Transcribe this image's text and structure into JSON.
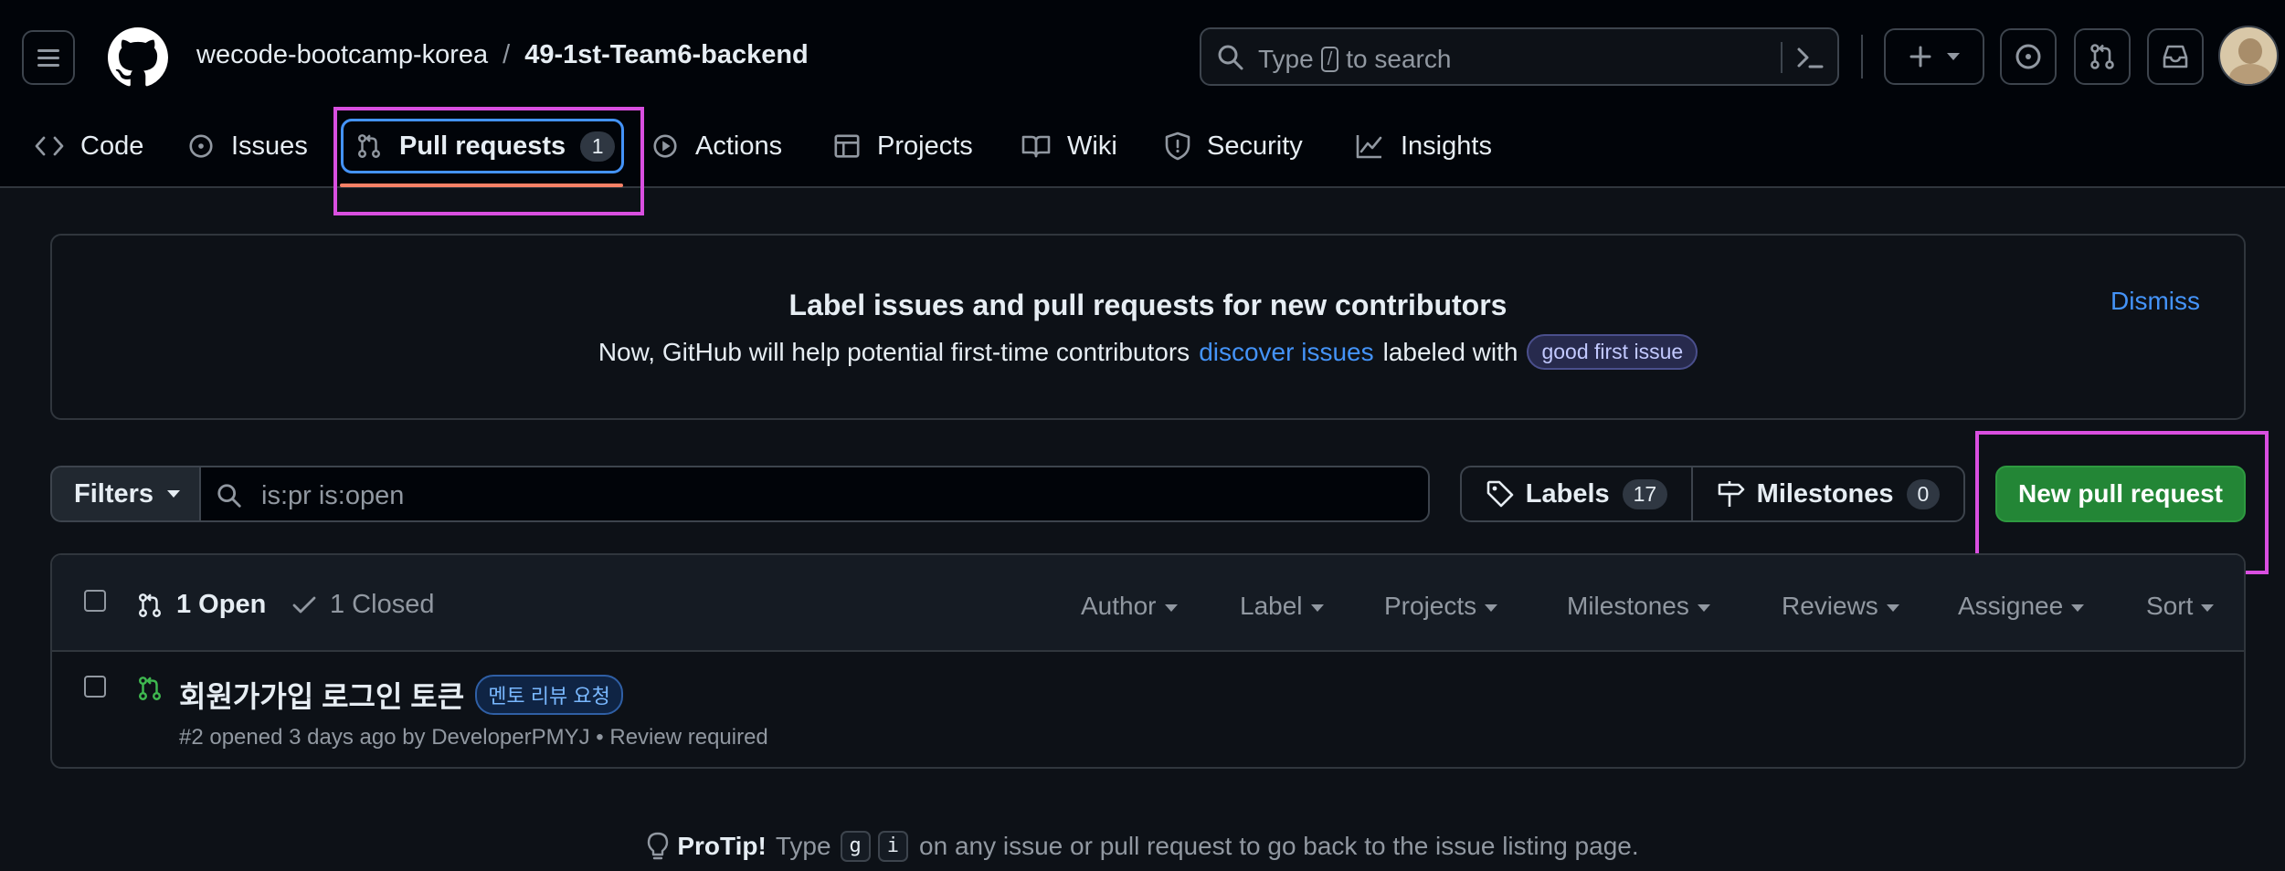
{
  "header": {
    "owner": "wecode-bootcamp-korea",
    "separator": "/",
    "repo": "49-1st-Team6-backend",
    "search_placeholder_prefix": "Type",
    "search_key": "/",
    "search_placeholder_suffix": "to search"
  },
  "tabs": [
    {
      "label": "Code",
      "icon": "code-icon"
    },
    {
      "label": "Issues",
      "icon": "issue-opened-icon"
    },
    {
      "label": "Pull requests",
      "icon": "git-pull-request-icon",
      "count": "1",
      "active": true
    },
    {
      "label": "Actions",
      "icon": "play-icon"
    },
    {
      "label": "Projects",
      "icon": "table-icon"
    },
    {
      "label": "Wiki",
      "icon": "book-icon"
    },
    {
      "label": "Security",
      "icon": "shield-icon"
    },
    {
      "label": "Insights",
      "icon": "graph-icon"
    }
  ],
  "banner": {
    "title": "Label issues and pull requests for new contributors",
    "desc_prefix": "Now, GitHub will help potential first-time contributors",
    "desc_link": "discover issues",
    "desc_mid": "labeled with",
    "label": "good first issue",
    "dismiss": "Dismiss"
  },
  "filterbar": {
    "filters_label": "Filters",
    "query": "is:pr is:open",
    "labels_label": "Labels",
    "labels_count": "17",
    "milestones_label": "Milestones",
    "milestones_count": "0",
    "new_pr_label": "New pull request"
  },
  "list": {
    "open_label": "1 Open",
    "closed_label": "1 Closed",
    "filters": [
      "Author",
      "Label",
      "Projects",
      "Milestones",
      "Reviews",
      "Assignee",
      "Sort"
    ],
    "items": [
      {
        "title": "회원가가입 로그인 토큰",
        "label": "멘토 리뷰 요청",
        "meta": "#2 opened 3 days ago by DeveloperPMYJ • Review required"
      }
    ]
  },
  "protip": {
    "strong": "ProTip!",
    "prefix": "Type",
    "key1": "g",
    "key2": "i",
    "suffix": "on any issue or pull request to go back to the issue listing page."
  },
  "colors": {
    "accent": "#4493f8",
    "active_underline": "#f78166",
    "primary_button": "#238636",
    "highlight_box": "#d94fe0"
  }
}
